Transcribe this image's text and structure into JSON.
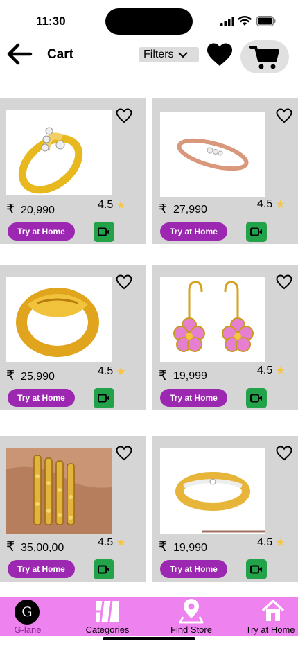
{
  "status_bar": {
    "time": "11:30"
  },
  "header": {
    "title": "Cart",
    "filters_label": "Filters"
  },
  "products": [
    {
      "name": "ring-diamond-swirl",
      "currency": "₹",
      "price": "20,990",
      "rating": "4.5",
      "try_label": "Try at Home"
    },
    {
      "name": "ring-rose-gold",
      "currency": "₹",
      "price": "27,990",
      "rating": "4.5",
      "try_label": "Try at Home"
    },
    {
      "name": "ring-gold-hands",
      "currency": "₹",
      "price": "25,990",
      "rating": "4.5",
      "try_label": "Try at Home"
    },
    {
      "name": "earrings-pink-flower",
      "currency": "₹",
      "price": "19,999",
      "rating": "4.5",
      "try_label": "Try at Home"
    },
    {
      "name": "bangles-gold",
      "currency": "₹",
      "price": "35,00,00",
      "rating": "4.5",
      "try_label": "Try at Home"
    },
    {
      "name": "band-gold-white",
      "currency": "₹",
      "price": "19,990",
      "rating": "4.5",
      "try_label": "Try at Home"
    }
  ],
  "bottom_nav": {
    "logo_text": "G",
    "items": [
      {
        "label": "G-lane",
        "icon": "g-lane-logo-icon"
      },
      {
        "label": "Categories",
        "icon": "categories-icon"
      },
      {
        "label": "Find Store",
        "icon": "store-pin-icon"
      },
      {
        "label": "Try at Home",
        "icon": "home-icon"
      }
    ]
  },
  "colors": {
    "accent_purple": "#9c27b0",
    "nav_pink": "#ee82ee",
    "card_gray": "#d5d5d5",
    "video_green": "#22a34a",
    "star_yellow": "#f6c544"
  }
}
